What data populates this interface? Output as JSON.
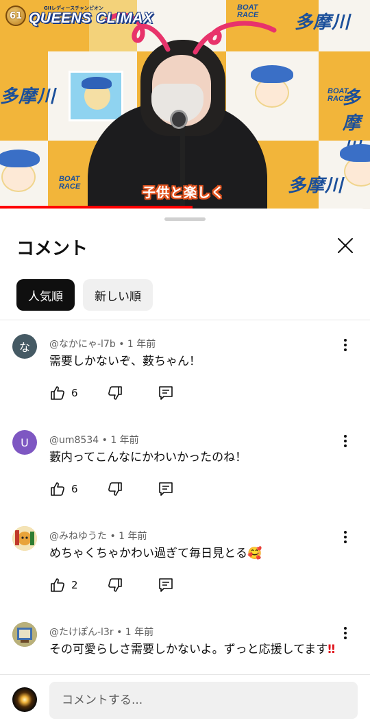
{
  "video": {
    "brand_badge": "61",
    "brand_sub": "GIIレディースチャンピオン",
    "brand_title": "QUEENS CLIMAX",
    "boat_logo_1": "BOAT",
    "boat_logo_2": "RACE",
    "venue": "多摩川",
    "caption": "子供と楽しく",
    "progress_fraction": 0.52
  },
  "panel": {
    "title": "コメント",
    "sort_chips": [
      {
        "label": "人気順",
        "selected": true
      },
      {
        "label": "新しい順",
        "selected": false
      }
    ]
  },
  "comments": [
    {
      "author": "@なかにゃ-l7b",
      "time": "1 年前",
      "text": "需要しかないぞ、薮ちゃん！",
      "likes": "6",
      "avatar": {
        "letter": "な",
        "color": "#455a64"
      }
    },
    {
      "author": "@um8534",
      "time": "1 年前",
      "text": "藪内ってこんなにかわいかったのね！",
      "likes": "6",
      "avatar": {
        "letter": "U",
        "color": "#7e57c2"
      }
    },
    {
      "author": "@みねゆうた",
      "time": "1 年前",
      "text": "めちゃくちゃかわい過ぎて毎日見とる🥰",
      "likes": "2",
      "avatar": {
        "letter": "",
        "color": "#e7c27a"
      }
    },
    {
      "author": "@たけぽん-l3r",
      "time": "1 年前",
      "text": "その可愛らしさ需要しかないよ。ずっと応援してます",
      "text_suffix": "‼",
      "likes": "",
      "avatar": {
        "letter": "",
        "color": "#8a8f5a"
      }
    }
  ],
  "composer": {
    "placeholder": "コメントする..."
  },
  "colors": {
    "accent": "#ff0000",
    "chip_active_bg": "#0f0f0f",
    "chip_inactive_bg": "#f0f0f0",
    "meta_text": "#606060"
  },
  "icons": {
    "like": "thumbs-up-icon",
    "dislike": "thumbs-down-icon",
    "reply": "reply-comment-icon",
    "more": "more-vertical-icon",
    "close": "close-icon"
  }
}
